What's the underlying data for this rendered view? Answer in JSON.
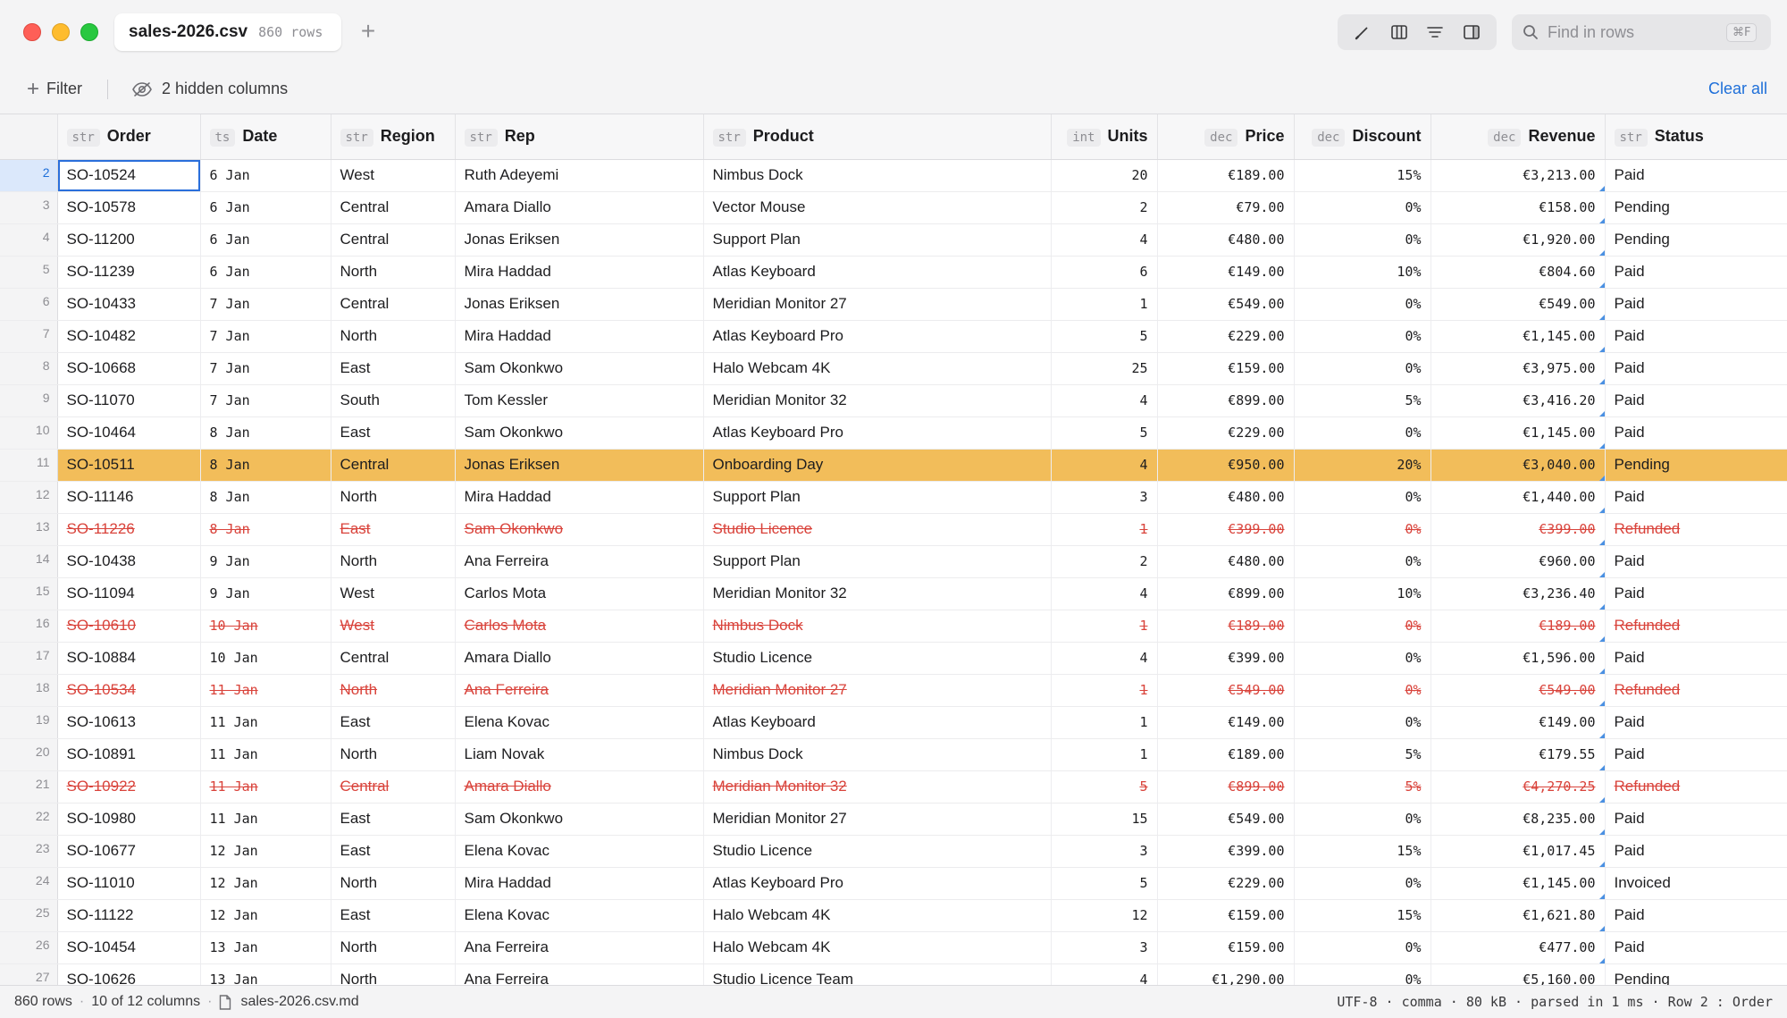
{
  "tab": {
    "filename": "sales-2026.csv",
    "rows": "860 rows"
  },
  "toolbar": {
    "icons": [
      "pencil-icon",
      "columns-icon",
      "lines-icon",
      "sidebar-icon"
    ]
  },
  "search": {
    "placeholder": "Find in rows",
    "shortcut": "⌘F"
  },
  "filterbar": {
    "filter_label": "Filter",
    "hidden_label": "2 hidden columns",
    "clear_label": "Clear all"
  },
  "columns": [
    {
      "type": "str",
      "name": "Order"
    },
    {
      "type": "ts",
      "name": "Date"
    },
    {
      "type": "str",
      "name": "Region"
    },
    {
      "type": "str",
      "name": "Rep"
    },
    {
      "type": "str",
      "name": "Product"
    },
    {
      "type": "int",
      "name": "Units"
    },
    {
      "type": "dec",
      "name": "Price"
    },
    {
      "type": "dec",
      "name": "Discount"
    },
    {
      "type": "dec",
      "name": "Revenue"
    },
    {
      "type": "str",
      "name": "Status"
    }
  ],
  "rows": [
    {
      "idx": "2",
      "state": "selected",
      "cells": [
        "SO-10524",
        "6 Jan",
        "West",
        "Ruth Adeyemi",
        "Nimbus Dock",
        "20",
        "€189.00",
        "15%",
        "€3,213.00",
        "Paid"
      ]
    },
    {
      "idx": "3",
      "state": "",
      "cells": [
        "SO-10578",
        "6 Jan",
        "Central",
        "Amara Diallo",
        "Vector Mouse",
        "2",
        "€79.00",
        "0%",
        "€158.00",
        "Pending"
      ]
    },
    {
      "idx": "4",
      "state": "",
      "cells": [
        "SO-11200",
        "6 Jan",
        "Central",
        "Jonas Eriksen",
        "Support Plan",
        "4",
        "€480.00",
        "0%",
        "€1,920.00",
        "Pending"
      ]
    },
    {
      "idx": "5",
      "state": "",
      "cells": [
        "SO-11239",
        "6 Jan",
        "North",
        "Mira Haddad",
        "Atlas Keyboard",
        "6",
        "€149.00",
        "10%",
        "€804.60",
        "Paid"
      ]
    },
    {
      "idx": "6",
      "state": "",
      "cells": [
        "SO-10433",
        "7 Jan",
        "Central",
        "Jonas Eriksen",
        "Meridian Monitor 27",
        "1",
        "€549.00",
        "0%",
        "€549.00",
        "Paid"
      ]
    },
    {
      "idx": "7",
      "state": "",
      "cells": [
        "SO-10482",
        "7 Jan",
        "North",
        "Mira Haddad",
        "Atlas Keyboard Pro",
        "5",
        "€229.00",
        "0%",
        "€1,145.00",
        "Paid"
      ]
    },
    {
      "idx": "8",
      "state": "",
      "cells": [
        "SO-10668",
        "7 Jan",
        "East",
        "Sam Okonkwo",
        "Halo Webcam 4K",
        "25",
        "€159.00",
        "0%",
        "€3,975.00",
        "Paid"
      ]
    },
    {
      "idx": "9",
      "state": "",
      "cells": [
        "SO-11070",
        "7 Jan",
        "South",
        "Tom Kessler",
        "Meridian Monitor 32",
        "4",
        "€899.00",
        "5%",
        "€3,416.20",
        "Paid"
      ]
    },
    {
      "idx": "10",
      "state": "",
      "cells": [
        "SO-10464",
        "8 Jan",
        "East",
        "Sam Okonkwo",
        "Atlas Keyboard Pro",
        "5",
        "€229.00",
        "0%",
        "€1,145.00",
        "Paid"
      ]
    },
    {
      "idx": "11",
      "state": "highlight",
      "cells": [
        "SO-10511",
        "8 Jan",
        "Central",
        "Jonas Eriksen",
        "Onboarding Day",
        "4",
        "€950.00",
        "20%",
        "€3,040.00",
        "Pending"
      ]
    },
    {
      "idx": "12",
      "state": "",
      "cells": [
        "SO-11146",
        "8 Jan",
        "North",
        "Mira Haddad",
        "Support Plan",
        "3",
        "€480.00",
        "0%",
        "€1,440.00",
        "Paid"
      ]
    },
    {
      "idx": "13",
      "state": "refund",
      "cells": [
        "SO-11226",
        "8 Jan",
        "East",
        "Sam Okonkwo",
        "Studio Licence",
        "1",
        "€399.00",
        "0%",
        "€399.00",
        "Refunded"
      ]
    },
    {
      "idx": "14",
      "state": "",
      "cells": [
        "SO-10438",
        "9 Jan",
        "North",
        "Ana Ferreira",
        "Support Plan",
        "2",
        "€480.00",
        "0%",
        "€960.00",
        "Paid"
      ]
    },
    {
      "idx": "15",
      "state": "",
      "cells": [
        "SO-11094",
        "9 Jan",
        "West",
        "Carlos Mota",
        "Meridian Monitor 32",
        "4",
        "€899.00",
        "10%",
        "€3,236.40",
        "Paid"
      ]
    },
    {
      "idx": "16",
      "state": "refund",
      "cells": [
        "SO-10610",
        "10 Jan",
        "West",
        "Carlos Mota",
        "Nimbus Dock",
        "1",
        "€189.00",
        "0%",
        "€189.00",
        "Refunded"
      ]
    },
    {
      "idx": "17",
      "state": "",
      "cells": [
        "SO-10884",
        "10 Jan",
        "Central",
        "Amara Diallo",
        "Studio Licence",
        "4",
        "€399.00",
        "0%",
        "€1,596.00",
        "Paid"
      ]
    },
    {
      "idx": "18",
      "state": "refund",
      "cells": [
        "SO-10534",
        "11 Jan",
        "North",
        "Ana Ferreira",
        "Meridian Monitor 27",
        "1",
        "€549.00",
        "0%",
        "€549.00",
        "Refunded"
      ]
    },
    {
      "idx": "19",
      "state": "",
      "cells": [
        "SO-10613",
        "11 Jan",
        "East",
        "Elena Kovac",
        "Atlas Keyboard",
        "1",
        "€149.00",
        "0%",
        "€149.00",
        "Paid"
      ]
    },
    {
      "idx": "20",
      "state": "",
      "cells": [
        "SO-10891",
        "11 Jan",
        "North",
        "Liam Novak",
        "Nimbus Dock",
        "1",
        "€189.00",
        "5%",
        "€179.55",
        "Paid"
      ]
    },
    {
      "idx": "21",
      "state": "refund",
      "cells": [
        "SO-10922",
        "11 Jan",
        "Central",
        "Amara Diallo",
        "Meridian Monitor 32",
        "5",
        "€899.00",
        "5%",
        "€4,270.25",
        "Refunded"
      ]
    },
    {
      "idx": "22",
      "state": "",
      "cells": [
        "SO-10980",
        "11 Jan",
        "East",
        "Sam Okonkwo",
        "Meridian Monitor 27",
        "15",
        "€549.00",
        "0%",
        "€8,235.00",
        "Paid"
      ]
    },
    {
      "idx": "23",
      "state": "",
      "cells": [
        "SO-10677",
        "12 Jan",
        "East",
        "Elena Kovac",
        "Studio Licence",
        "3",
        "€399.00",
        "15%",
        "€1,017.45",
        "Paid"
      ]
    },
    {
      "idx": "24",
      "state": "",
      "cells": [
        "SO-11010",
        "12 Jan",
        "North",
        "Mira Haddad",
        "Atlas Keyboard Pro",
        "5",
        "€229.00",
        "0%",
        "€1,145.00",
        "Invoiced"
      ]
    },
    {
      "idx": "25",
      "state": "",
      "cells": [
        "SO-11122",
        "12 Jan",
        "East",
        "Elena Kovac",
        "Halo Webcam 4K",
        "12",
        "€159.00",
        "15%",
        "€1,621.80",
        "Paid"
      ]
    },
    {
      "idx": "26",
      "state": "",
      "cells": [
        "SO-10454",
        "13 Jan",
        "North",
        "Ana Ferreira",
        "Halo Webcam 4K",
        "3",
        "€159.00",
        "0%",
        "€477.00",
        "Paid"
      ]
    },
    {
      "idx": "27",
      "state": "",
      "cells": [
        "SO-10626",
        "13 Jan",
        "North",
        "Ana Ferreira",
        "Studio Licence Team",
        "4",
        "€1,290.00",
        "0%",
        "€5,160.00",
        "Pending"
      ]
    }
  ],
  "statusbar": {
    "rows": "860 rows",
    "columns": "10 of 12 columns",
    "file": "sales-2026.csv.md",
    "right": "UTF-8 · comma · 80 kB · parsed in 1 ms · Row 2 : Order"
  },
  "colors": {
    "accent": "#1e6fd9",
    "highlight": "#f2bd5a",
    "refund": "#d9433b"
  }
}
